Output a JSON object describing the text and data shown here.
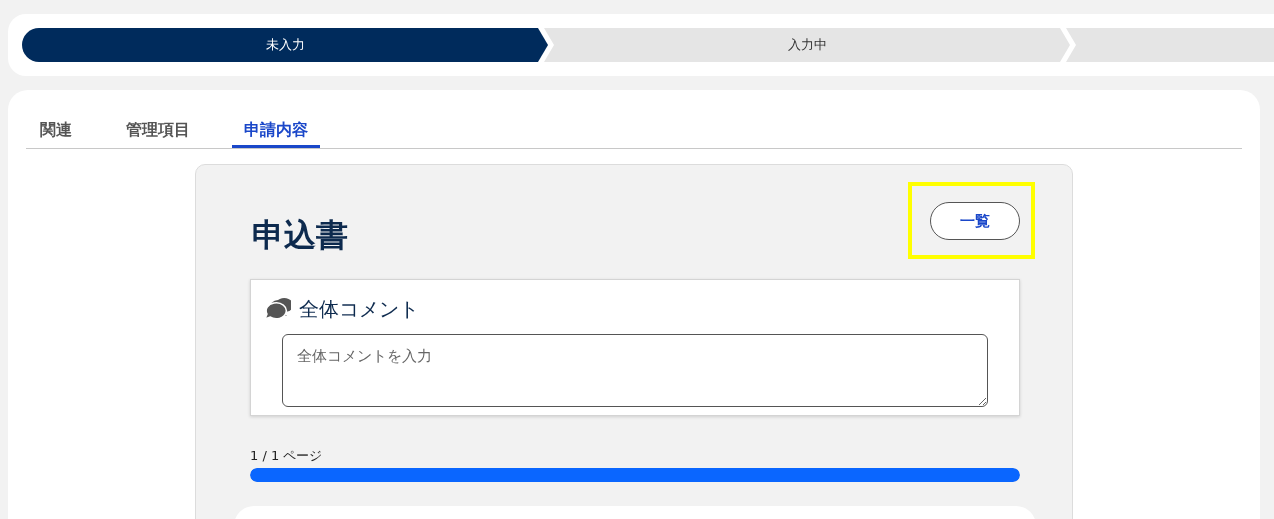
{
  "steps": [
    {
      "label": "未入力",
      "current": true
    },
    {
      "label": "入力中",
      "current": false
    },
    {
      "current": false
    }
  ],
  "tabs": [
    {
      "label": "関連",
      "selected": false
    },
    {
      "label": "管理項目",
      "selected": false
    },
    {
      "label": "申請内容",
      "selected": true
    }
  ],
  "form": {
    "title": "申込書",
    "list_button": {
      "label": "一覧",
      "highlighted": true
    },
    "comment": {
      "title": "全体コメント",
      "placeholder": "全体コメントを入力"
    },
    "progress": {
      "reading": "1 / 1 ページ",
      "level": 1
    }
  }
}
